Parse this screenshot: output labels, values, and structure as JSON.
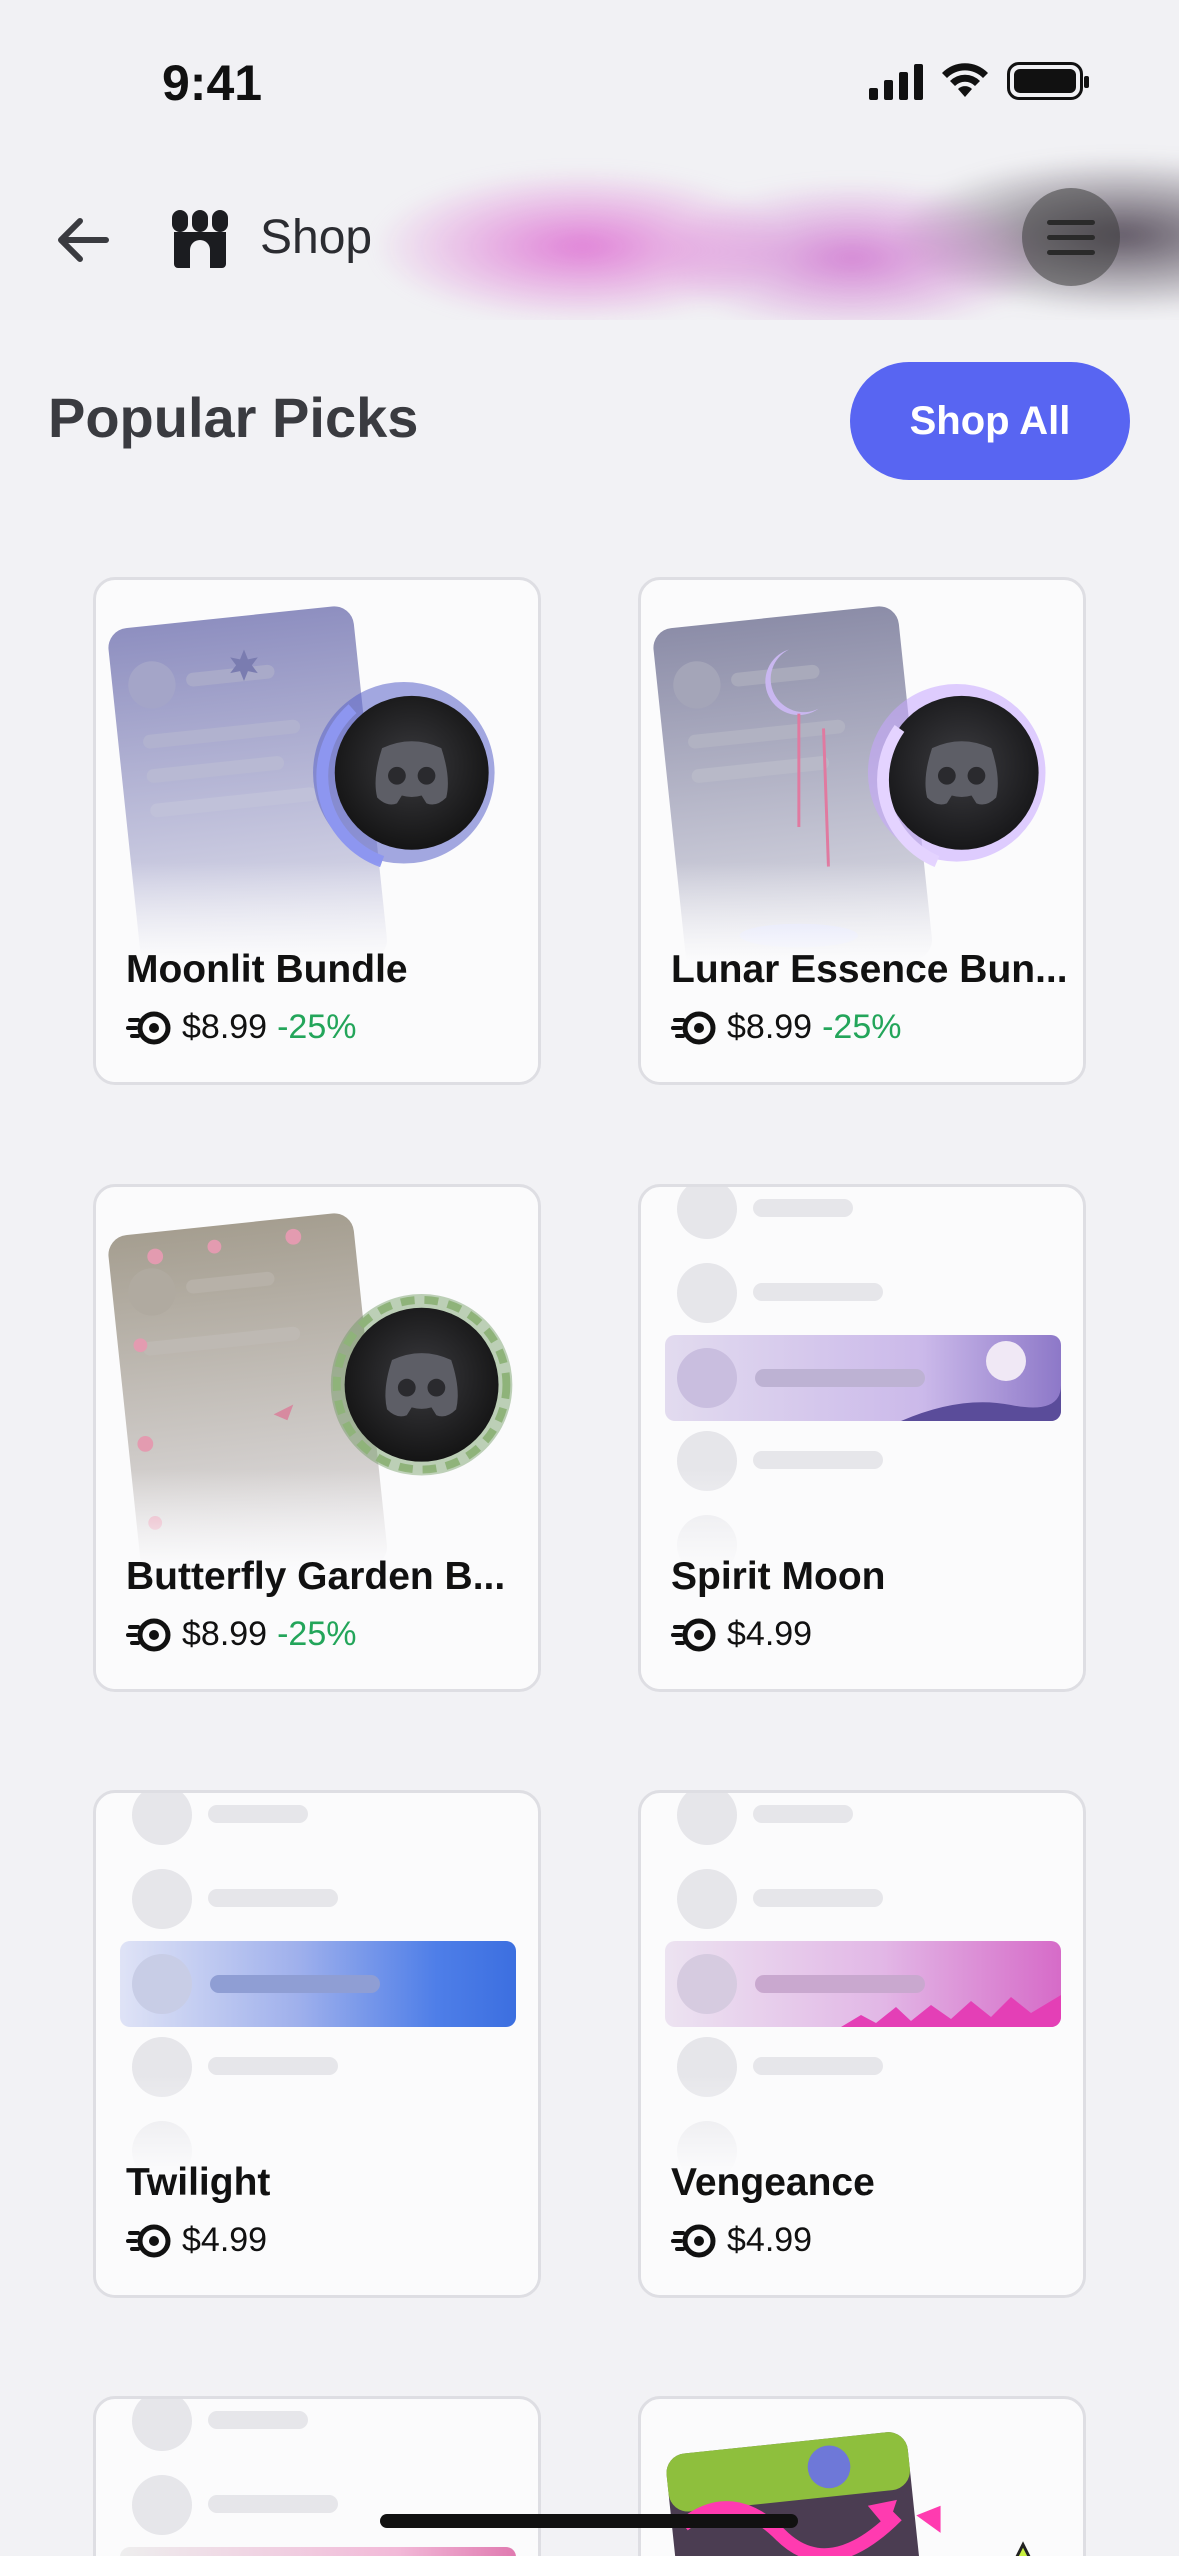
{
  "status_bar": {
    "time": "9:41"
  },
  "header": {
    "title": "Shop",
    "icons": {
      "back": "arrow-left-icon",
      "shop": "storefront-icon",
      "menu": "hamburger-menu-icon"
    }
  },
  "section": {
    "title": "Popular Picks",
    "action_label": "Shop All"
  },
  "colors": {
    "accent": "#5865f2",
    "discount": "#23a55a",
    "card_border": "#dedee3"
  },
  "products": [
    {
      "name": "Moonlit Bundle",
      "price": "$8.99",
      "discount": "-25%"
    },
    {
      "name": "Lunar Essence Bun...",
      "price": "$8.99",
      "discount": "-25%"
    },
    {
      "name": "Butterfly Garden B...",
      "price": "$8.99",
      "discount": "-25%"
    },
    {
      "name": "Spirit Moon",
      "price": "$4.99",
      "discount": ""
    },
    {
      "name": "Twilight",
      "price": "$4.99",
      "discount": ""
    },
    {
      "name": "Vengeance",
      "price": "$4.99",
      "discount": ""
    }
  ],
  "product_badge_icon": "nitro-icon"
}
